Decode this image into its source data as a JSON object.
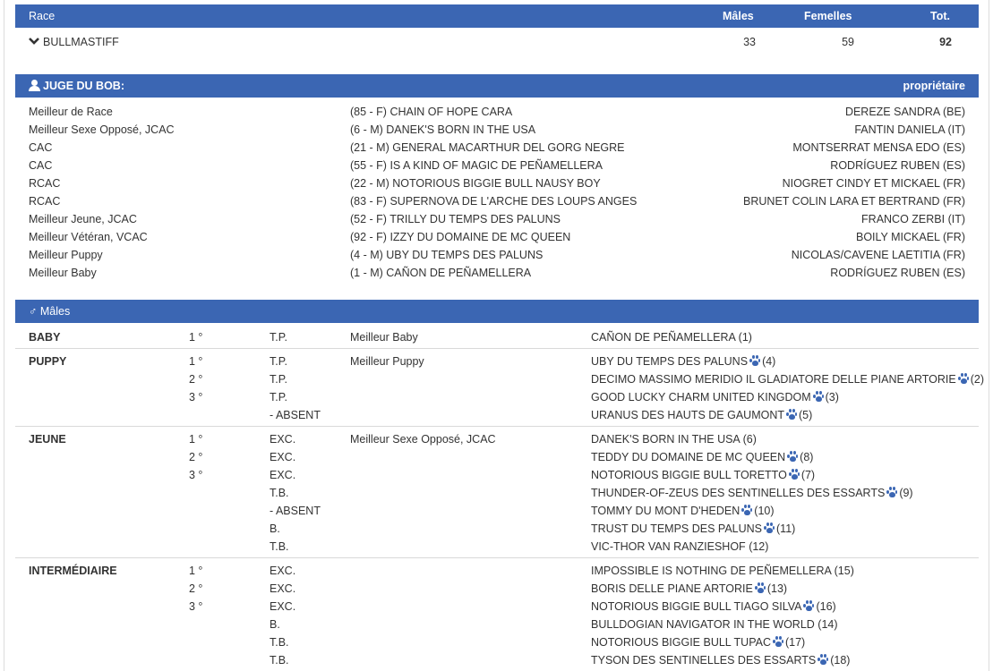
{
  "race_header": {
    "col_race": "Race",
    "col_males": "Mâles",
    "col_females": "Femelles",
    "col_total": "Tot."
  },
  "race_row": {
    "toggle_icon": "chevron-down-icon",
    "name": "BULLMASTIFF",
    "males": "33",
    "females": "59",
    "total": "92"
  },
  "judge_header": {
    "icon": "person-icon",
    "title": "JUGE DU BOB:",
    "owner_label": "propriétaire"
  },
  "awards": [
    {
      "award": "Meilleur de Race",
      "dog": "(85 - F) CHAIN OF HOPE CARA",
      "owner": "DEREZE SANDRA (BE)"
    },
    {
      "award": "Meilleur Sexe Opposé, JCAC",
      "dog": "(6 - M) DANEK'S BORN IN THE USA",
      "owner": "FANTIN DANIELA (IT)"
    },
    {
      "award": "CAC",
      "dog": "(21 - M) GENERAL MACARTHUR DEL GORG NEGRE",
      "owner": "MONTSERRAT MENSA EDO (ES)"
    },
    {
      "award": "CAC",
      "dog": "(55 - F) IS A KIND OF MAGIC DE PEÑAMELLERA",
      "owner": "RODRÍGUEZ RUBEN (ES)"
    },
    {
      "award": "RCAC",
      "dog": "(22 - M) NOTORIOUS BIGGIE BULL NAUSY BOY",
      "owner": "NIOGRET CINDY ET MICKAEL (FR)"
    },
    {
      "award": "RCAC",
      "dog": "(83 - F) SUPERNOVA DE L'ARCHE DES LOUPS ANGES",
      "owner": "BRUNET COLIN LARA ET BERTRAND (FR)"
    },
    {
      "award": "Meilleur Jeune, JCAC",
      "dog": "(52 - F) TRILLY DU TEMPS DES PALUNS",
      "owner": "FRANCO ZERBI (IT)"
    },
    {
      "award": "Meilleur Vétéran, VCAC",
      "dog": "(92 - F) IZZY DU DOMAINE DE MC QUEEN",
      "owner": "BOILY MICKAEL (FR)"
    },
    {
      "award": "Meilleur Puppy",
      "dog": "(4 - M) UBY DU TEMPS DES PALUNS",
      "owner": "NICOLAS/CAVENE LAETITIA (FR)"
    },
    {
      "award": "Meilleur Baby",
      "dog": "(1 - M) CAÑON DE PEÑAMELLERA",
      "owner": "RODRÍGUEZ RUBEN (ES)"
    }
  ],
  "males_header": {
    "icon": "male-symbol-icon",
    "symbol": "♂",
    "title": "Mâles"
  },
  "paw_icon": "paw-icon",
  "classes": [
    {
      "name": "BABY",
      "entries": [
        {
          "rank": "1 °",
          "grade": "T.P.",
          "award": "Meilleur Baby",
          "dog": "CAÑON DE PEÑAMELLERA",
          "num": "(1)",
          "paw": false
        }
      ]
    },
    {
      "name": "PUPPY",
      "entries": [
        {
          "rank": "1 °",
          "grade": "T.P.",
          "award": "Meilleur Puppy",
          "dog": "UBY DU TEMPS DES PALUNS",
          "num": "(4)",
          "paw": true
        },
        {
          "rank": "2 °",
          "grade": "T.P.",
          "award": "",
          "dog": "DECIMO MASSIMO MERIDIO IL GLADIATORE DELLE PIANE ARTORIE",
          "num": "(2)",
          "paw": true
        },
        {
          "rank": "3 °",
          "grade": "T.P.",
          "award": "",
          "dog": "GOOD LUCKY CHARM UNITED KINGDOM",
          "num": "(3)",
          "paw": true
        },
        {
          "rank": "",
          "grade": "- ABSENT",
          "award": "",
          "dog": "URANUS DES HAUTS DE GAUMONT",
          "num": "(5)",
          "paw": true
        }
      ]
    },
    {
      "name": "JEUNE",
      "entries": [
        {
          "rank": "1 °",
          "grade": "EXC.",
          "award": "Meilleur Sexe Opposé, JCAC",
          "dog": "DANEK'S BORN IN THE USA",
          "num": "(6)",
          "paw": false
        },
        {
          "rank": "2 °",
          "grade": "EXC.",
          "award": "",
          "dog": "TEDDY DU DOMAINE DE MC QUEEN",
          "num": "(8)",
          "paw": true
        },
        {
          "rank": "3 °",
          "grade": "EXC.",
          "award": "",
          "dog": "NOTORIOUS BIGGIE BULL TORETTO",
          "num": "(7)",
          "paw": true
        },
        {
          "rank": "",
          "grade": "T.B.",
          "award": "",
          "dog": "THUNDER-OF-ZEUS DES SENTINELLES DES ESSARTS",
          "num": "(9)",
          "paw": true
        },
        {
          "rank": "",
          "grade": "- ABSENT",
          "award": "",
          "dog": "TOMMY DU MONT D'HEDEN",
          "num": "(10)",
          "paw": true
        },
        {
          "rank": "",
          "grade": "B.",
          "award": "",
          "dog": "TRUST DU TEMPS DES PALUNS",
          "num": "(11)",
          "paw": true
        },
        {
          "rank": "",
          "grade": "T.B.",
          "award": "",
          "dog": "VIC-THOR VAN RANZIESHOF",
          "num": "(12)",
          "paw": false
        }
      ]
    },
    {
      "name": "INTERMÉDIAIRE",
      "entries": [
        {
          "rank": "1 °",
          "grade": "EXC.",
          "award": "",
          "dog": "IMPOSSIBLE IS NOTHING DE PEÑEMELLERA",
          "num": "(15)",
          "paw": false
        },
        {
          "rank": "2 °",
          "grade": "EXC.",
          "award": "",
          "dog": "BORIS DELLE PIANE ARTORIE",
          "num": "(13)",
          "paw": true
        },
        {
          "rank": "3 °",
          "grade": "EXC.",
          "award": "",
          "dog": "NOTORIOUS BIGGIE BULL TIAGO SILVA",
          "num": "(16)",
          "paw": true
        },
        {
          "rank": "",
          "grade": "B.",
          "award": "",
          "dog": "BULLDOGIAN NAVIGATOR IN THE WORLD",
          "num": "(14)",
          "paw": false
        },
        {
          "rank": "",
          "grade": "T.B.",
          "award": "",
          "dog": "NOTORIOUS BIGGIE BULL TUPAC",
          "num": "(17)",
          "paw": true
        },
        {
          "rank": "",
          "grade": "T.B.",
          "award": "",
          "dog": "TYSON DES SENTINELLES DES ESSARTS",
          "num": "(18)",
          "paw": true
        }
      ]
    }
  ]
}
